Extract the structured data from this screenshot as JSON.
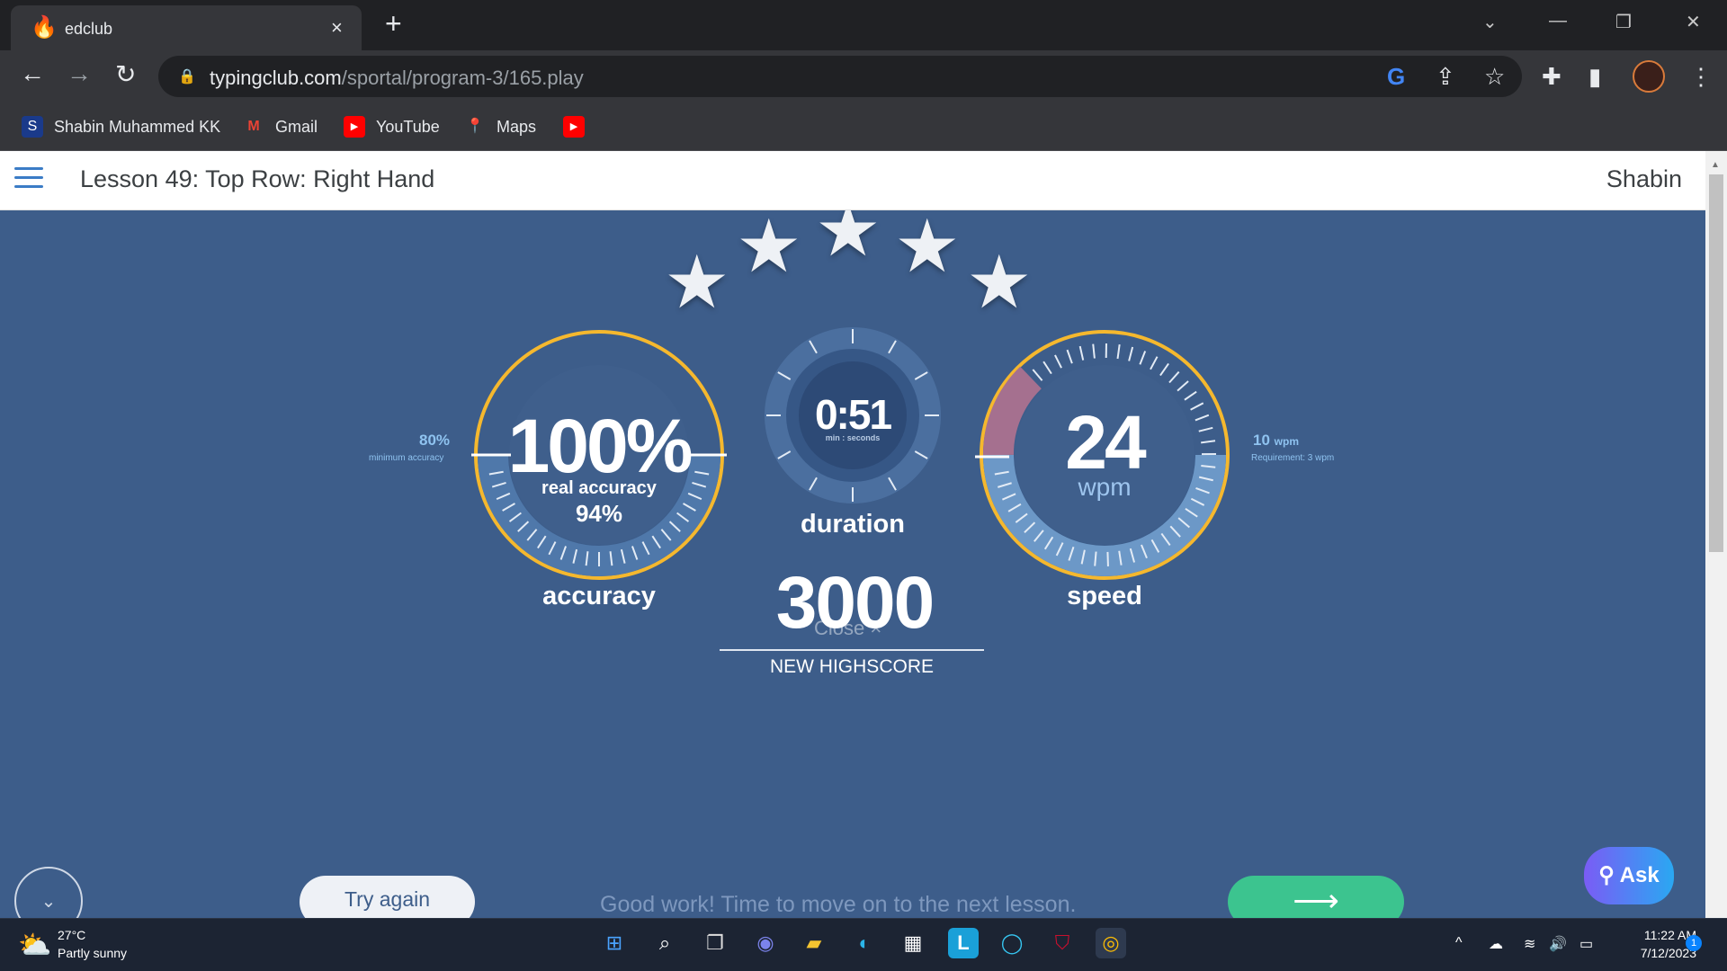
{
  "browser": {
    "tab_title": "edclub",
    "tab_close": "×",
    "new_tab": "+",
    "url_host": "typingclub.com",
    "url_path": "/sportal/program-3/165.play",
    "bookmarks": [
      {
        "label": "Shabin Muhammed KK",
        "icon": "S"
      },
      {
        "label": "Gmail",
        "icon": "M"
      },
      {
        "label": "YouTube",
        "icon": "▶"
      },
      {
        "label": "Maps",
        "icon": "📍"
      },
      {
        "label": "",
        "icon": "▶"
      }
    ]
  },
  "header": {
    "lesson_title": "Lesson 49: Top Row: Right Hand",
    "user_name": "Shabin"
  },
  "results": {
    "stars_earned": 5,
    "accuracy": {
      "value": "100%",
      "sub_label": "real accuracy",
      "sub_value": "94%",
      "label": "accuracy",
      "min_value": "80%",
      "min_label": "minimum accuracy"
    },
    "duration": {
      "value": "0:51",
      "unit": "min : seconds",
      "label": "duration"
    },
    "speed": {
      "value": "24",
      "unit": "wpm",
      "label": "speed",
      "req_value": "10",
      "req_unit": "wpm",
      "req_label": "Requirement: 3 wpm"
    },
    "highscore": {
      "value": "3000",
      "close_label": "Close ×",
      "label": "NEW HIGHSCORE"
    }
  },
  "footer": {
    "try_again": "Try again",
    "message": "Good work! Time to move on to the next lesson.",
    "next_arrow": "⟶",
    "ask": "Ask"
  },
  "taskbar": {
    "temperature": "27°C",
    "condition": "Partly sunny",
    "time": "11:22 AM",
    "date": "7/12/2023",
    "notifications": "1"
  },
  "colors": {
    "page_bg": "#3d5d8a",
    "gauge_ring": "#f5b82e",
    "next_button": "#3cc48f",
    "accent_text": "#8fc3f0"
  }
}
